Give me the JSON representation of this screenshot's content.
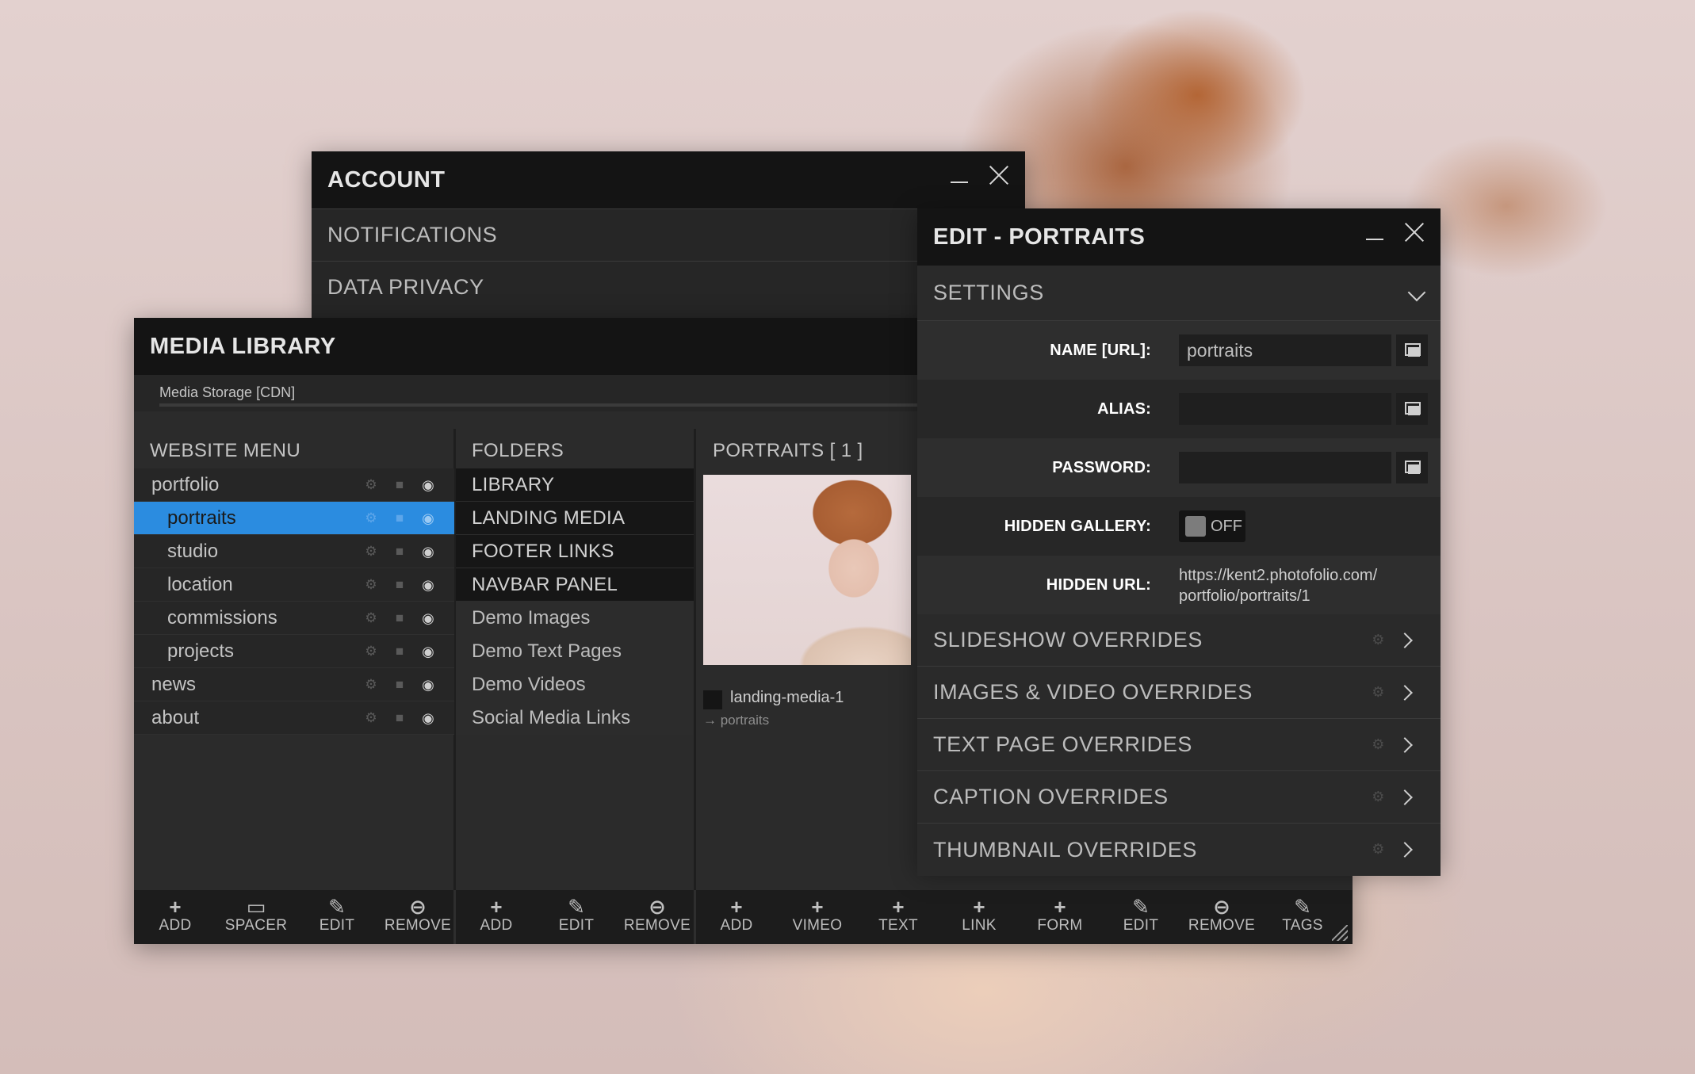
{
  "account": {
    "title": "ACCOUNT",
    "rows": [
      "NOTIFICATIONS",
      "DATA PRIVACY"
    ]
  },
  "media": {
    "title": "MEDIA LIBRARY",
    "storage": "Media Storage [CDN]",
    "website_menu": {
      "heading": "WEBSITE MENU",
      "items": [
        {
          "label": "portfolio",
          "sub": false,
          "active": false
        },
        {
          "label": "portraits",
          "sub": true,
          "active": true
        },
        {
          "label": "studio",
          "sub": true,
          "active": false
        },
        {
          "label": "location",
          "sub": true,
          "active": false
        },
        {
          "label": "commissions",
          "sub": true,
          "active": false
        },
        {
          "label": "projects",
          "sub": true,
          "active": false
        },
        {
          "label": "news",
          "sub": false,
          "active": false
        },
        {
          "label": "about",
          "sub": false,
          "active": false
        }
      ]
    },
    "folders": {
      "heading": "FOLDERS",
      "items": [
        "LIBRARY",
        "LANDING MEDIA",
        "FOOTER LINKS",
        "NAVBAR PANEL",
        "Demo Images",
        "Demo Text Pages",
        "Demo Videos",
        "Social Media Links"
      ]
    },
    "portraits": {
      "heading": "PORTRAITS  [ 1 ]",
      "item_name": "landing-media-1",
      "item_link": "→ portraits"
    },
    "toolbar": {
      "menu": [
        {
          "icon": "+",
          "label": "ADD"
        },
        {
          "icon": "▭",
          "label": "SPACER"
        },
        {
          "icon": "✎",
          "label": "EDIT"
        },
        {
          "icon": "⊖",
          "label": "REMOVE"
        }
      ],
      "folders": [
        {
          "icon": "+",
          "label": "ADD"
        },
        {
          "icon": "✎",
          "label": "EDIT"
        },
        {
          "icon": "⊖",
          "label": "REMOVE"
        }
      ],
      "media": [
        {
          "icon": "+",
          "label": "ADD"
        },
        {
          "icon": "+",
          "label": "VIMEO"
        },
        {
          "icon": "+",
          "label": "TEXT"
        },
        {
          "icon": "+",
          "label": "LINK"
        },
        {
          "icon": "+",
          "label": "FORM"
        },
        {
          "icon": "✎",
          "label": "EDIT"
        },
        {
          "icon": "⊖",
          "label": "REMOVE"
        },
        {
          "icon": "✎",
          "label": "TAGS"
        }
      ]
    }
  },
  "edit": {
    "title": "EDIT - PORTRAITS",
    "settings_label": "SETTINGS",
    "fields": {
      "name_label": "NAME [URL]:",
      "name_value": "portraits",
      "alias_label": "ALIAS:",
      "alias_value": "",
      "password_label": "PASSWORD:",
      "password_value": "",
      "hidden_gallery_label": "HIDDEN GALLERY:",
      "hidden_gallery_state": "OFF",
      "hidden_url_label": "HIDDEN URL:",
      "hidden_url_line1": "https://kent2.photofolio.com/",
      "hidden_url_line2": "portfolio/portraits/1"
    },
    "sections": [
      "SLIDESHOW OVERRIDES",
      "IMAGES & VIDEO OVERRIDES",
      "TEXT PAGE OVERRIDES",
      "CAPTION OVERRIDES",
      "THUMBNAIL OVERRIDES"
    ]
  },
  "colors": {
    "accent": "#2b8ce0",
    "title_bar": "#141414",
    "panel": "#2a2a2a"
  }
}
